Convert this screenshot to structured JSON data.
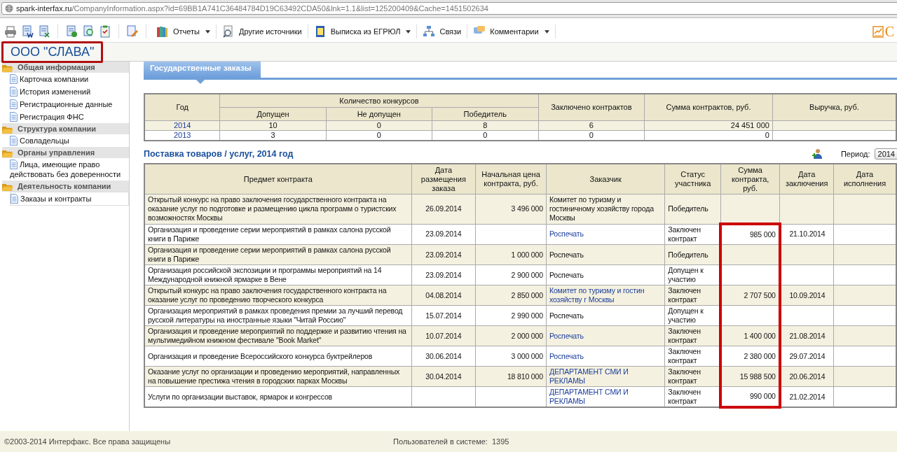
{
  "address_bar": {
    "host": "spark-interfax.ru",
    "path": "/CompanyInformation.aspx?id=69BB1A741C36484784D19C63492CDA50&lnk=1.1&list=125200409&Cache=1451502634"
  },
  "toolbar": {
    "menus": [
      {
        "label": "Отчеты",
        "dropdown": true
      },
      {
        "label": "Другие источники",
        "dropdown": false
      },
      {
        "label": "Выписка из ЕГРЮЛ",
        "dropdown": true
      },
      {
        "label": "Связи",
        "dropdown": false
      },
      {
        "label": "Комментарии",
        "dropdown": true
      }
    ],
    "logo": "С"
  },
  "company": {
    "name": "ООО \"СЛАВА\"",
    "highlighted": true
  },
  "sidebar": {
    "groups": [
      {
        "title": "Общая информация",
        "items": [
          {
            "label": "Карточка компании",
            "selected": false
          },
          {
            "label": "История изменений",
            "selected": false
          },
          {
            "label": "Регистрационные данные",
            "selected": false
          },
          {
            "label": "Регистрация ФНС",
            "selected": false
          }
        ]
      },
      {
        "title": "Структура компании",
        "items": [
          {
            "label": "Совладельцы",
            "selected": false
          }
        ]
      },
      {
        "title": "Органы управления",
        "items": [
          {
            "label": "Лица, имеющие право действовать без доверенности",
            "selected": false
          }
        ]
      },
      {
        "title": "Деятельность компании",
        "items": [
          {
            "label": "Заказы и контракты",
            "selected": true
          }
        ]
      }
    ]
  },
  "tab": {
    "label": "Государственные заказы"
  },
  "summary_table": {
    "columns": {
      "year": "Год",
      "contests": "Количество конкурсов",
      "admitted": "Допущен",
      "not_admitted": "Не допущен",
      "winner": "Победитель",
      "contracts": "Заключено контрактов",
      "sum": "Сумма контрактов, руб.",
      "revenue": "Выручка, руб."
    },
    "rows": [
      {
        "year": "2014",
        "admitted": "10",
        "not_admitted": "0",
        "winner": "8",
        "contracts": "6",
        "sum": "24 451 000"
      },
      {
        "year": "2013",
        "admitted": "3",
        "not_admitted": "0",
        "winner": "0",
        "contracts": "0",
        "sum": "0"
      }
    ]
  },
  "section_title": "Поставка товаров / услуг, 2014 год",
  "period": {
    "label": "Период:",
    "value": "2014"
  },
  "contracts_table": {
    "columns": [
      "Предмет контракта",
      "Дата размещения заказа",
      "Начальная цена контракта, руб.",
      "Заказчик",
      "Статус участника",
      "Сумма контракта, руб.",
      "Дата заключения",
      "Дата исполнения"
    ],
    "rows": [
      {
        "subject": "Открытый конкурс на право заключения государственного контракта на оказание услуг по подготовке и размещению цикла программ о туристских возможностях Москвы",
        "date": "26.09.2014",
        "price": "3 496 000",
        "customer": "Комитет по туризму и гостиничному хозяйству города Москвы",
        "customer_link": false,
        "status": "Победитель",
        "sum": "",
        "concluded": "",
        "highlighted": false
      },
      {
        "subject": "Организация и проведение серии мероприятий в рамках салона русской книги в Париже",
        "date": "23.09.2014",
        "price": "",
        "customer": "Роспечать",
        "customer_link": true,
        "status": "Заключен контракт",
        "sum": "985 000",
        "concluded": "21.10.2014",
        "highlighted": true
      },
      {
        "subject": "Организация и проведение серии мероприятий в рамках салона русской книги в Париже",
        "date": "23.09.2014",
        "price": "1 000 000",
        "customer": "Роспечать",
        "customer_link": false,
        "status": "Победитель",
        "sum": "",
        "concluded": "",
        "highlighted": true
      },
      {
        "subject": "Организация российской экспозиции и программы мероприятий на 14 Международной книжной ярмарке в Вене",
        "date": "23.09.2014",
        "price": "2 900 000",
        "customer": "Роспечать",
        "customer_link": false,
        "status": "Допущен к участию",
        "sum": "",
        "concluded": "",
        "highlighted": true
      },
      {
        "subject": "Открытый конкурс на право заключения государственного контракта на оказание услуг по проведению творческого конкурса",
        "date": "04.08.2014",
        "price": "2 850 000",
        "customer": "Комитет по туризму и гостин хозяйству г Москвы",
        "customer_link": true,
        "status": "Заключен контракт",
        "sum": "2 707 500",
        "concluded": "10.09.2014",
        "highlighted": true
      },
      {
        "subject": "Организация мероприятий в рамках проведения премии за лучший перевод русской литературы на иностранные языки \"Читай Россию\"",
        "date": "15.07.2014",
        "price": "2 990 000",
        "customer": "Роспечать",
        "customer_link": false,
        "status": "Допущен к участию",
        "sum": "",
        "concluded": "",
        "highlighted": true
      },
      {
        "subject": "Организация и проведение мероприятий по поддержке и развитию чтения на мультимедийном книжном фестивале \"Book Market\"",
        "date": "10.07.2014",
        "price": "2 000 000",
        "customer": "Роспечать",
        "customer_link": true,
        "status": "Заключен контракт",
        "sum": "1 400 000",
        "concluded": "21.08.2014",
        "highlighted": true
      },
      {
        "subject": "Организация и проведение Всероссийского конкурса буктрейлеров",
        "date": "30.06.2014",
        "price": "3 000 000",
        "customer": "Роспечать",
        "customer_link": true,
        "status": "Заключен контракт",
        "sum": "2 380 000",
        "concluded": "29.07.2014",
        "highlighted": true
      },
      {
        "subject": "Оказание услуг по организации и проведению мероприятий, направленных на повышение престижа чтения в городских парках Москвы",
        "date": "30.04.2014",
        "price": "18 810 000",
        "customer": "ДЕПАРТАМЕНТ СМИ И РЕКЛАМЫ",
        "customer_link": true,
        "status": "Заключен контракт",
        "sum": "15 988 500",
        "concluded": "20.06.2014",
        "highlighted": true
      },
      {
        "subject": "Услуги по организации выставок, ярмарок и конгрессов",
        "date": "",
        "price": "",
        "customer": "ДЕПАРТАМЕНТ СМИ И РЕКЛАМЫ",
        "customer_link": true,
        "status": "Заключен контракт",
        "sum": "990 000",
        "concluded": "21.02.2014",
        "highlighted": true
      }
    ]
  },
  "footer": {
    "copyright": "©2003-2014 Интерфакс. Все права защищены",
    "users_label": "Пользователей в системе:",
    "users_count": "1395"
  }
}
